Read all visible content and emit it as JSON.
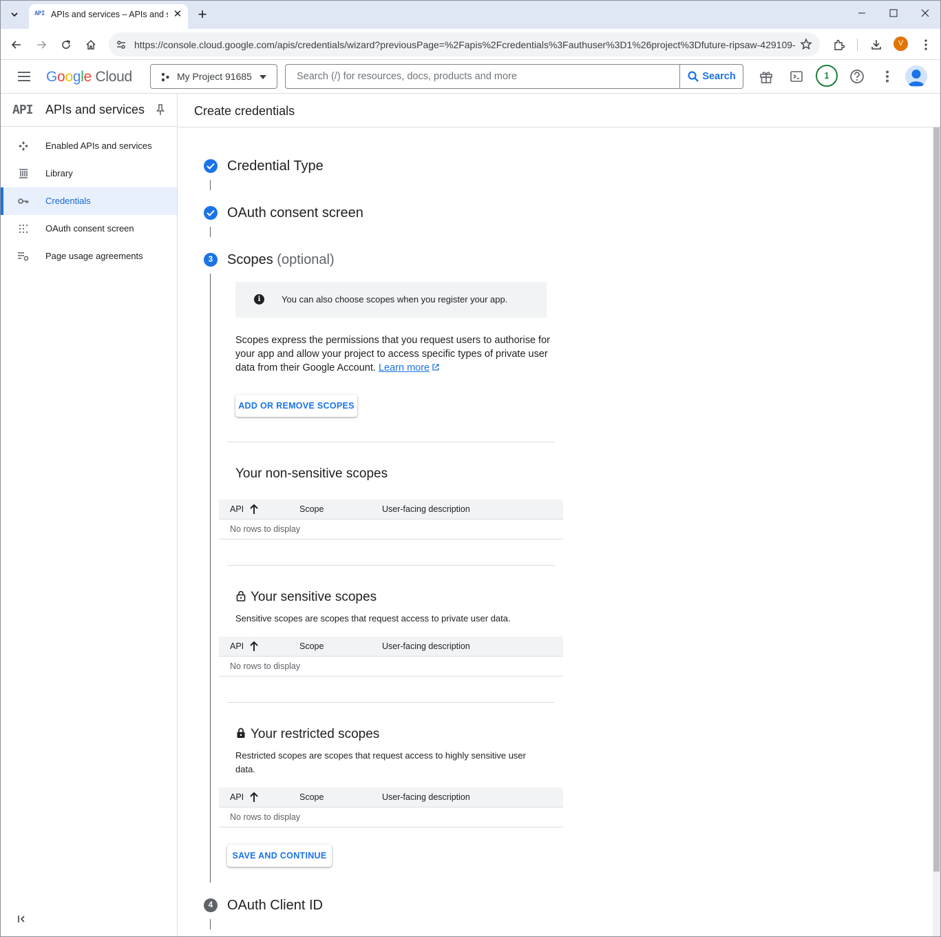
{
  "browser": {
    "tab_title": "APIs and services – APIs and services",
    "tab_favicon_text": "API",
    "url": "https://console.cloud.google.com/apis/credentials/wizard?previousPage=%2Fapis%2Fcredentials%3Fauthuser%3D1%26project%3Dfuture-ripsaw-429109-...",
    "profile_initial": "V"
  },
  "header": {
    "logo_google": "Google",
    "logo_cloud": "Cloud",
    "project": "My Project 91685",
    "search_placeholder": "Search (/) for resources, docs, products and more",
    "search_button": "Search",
    "notification_count": "1"
  },
  "sidebar": {
    "api_badge": "API",
    "title": "APIs and services",
    "items": [
      {
        "label": "Enabled APIs and services",
        "icon": "enabled-apis-icon"
      },
      {
        "label": "Library",
        "icon": "library-icon"
      },
      {
        "label": "Credentials",
        "icon": "key-icon",
        "active": true
      },
      {
        "label": "OAuth consent screen",
        "icon": "consent-icon"
      },
      {
        "label": "Page usage agreements",
        "icon": "settings-list-icon"
      }
    ]
  },
  "main": {
    "page_title": "Create credentials",
    "steps": [
      {
        "number": "1",
        "title": "Credential Type",
        "state": "done"
      },
      {
        "number": "2",
        "title": "OAuth consent screen",
        "state": "done"
      },
      {
        "number": "3",
        "title": "Scopes",
        "optional": "(optional)",
        "state": "current"
      },
      {
        "number": "4",
        "title": "OAuth Client ID",
        "state": "todo"
      }
    ],
    "info": "You can also choose scopes when you register your app.",
    "description": "Scopes express the permissions that you request users to authorise for your app and allow your project to access specific types of private user data from their Google Account.",
    "learn_more": "Learn more",
    "add_remove_button": "ADD OR REMOVE SCOPES",
    "table_columns": [
      "API",
      "Scope",
      "User-facing description"
    ],
    "empty_text": "No rows to display",
    "non_sensitive": {
      "title": "Your non-sensitive scopes"
    },
    "sensitive": {
      "title": "Your sensitive scopes",
      "description": "Sensitive scopes are scopes that request access to private user data."
    },
    "restricted": {
      "title": "Your restricted scopes",
      "description": "Restricted scopes are scopes that request access to highly sensitive user data."
    },
    "save_button": "SAVE AND CONTINUE"
  }
}
